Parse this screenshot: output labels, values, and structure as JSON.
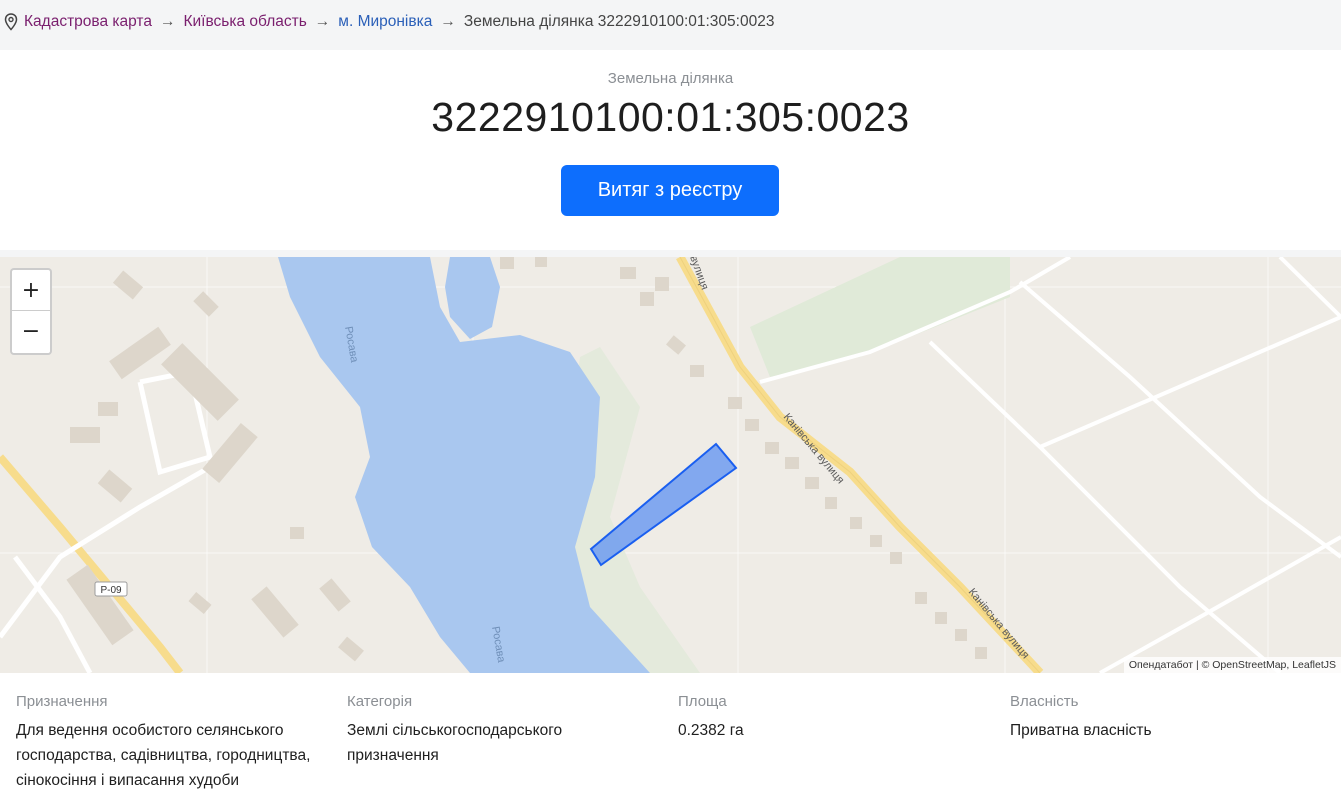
{
  "breadcrumb": {
    "pin_icon": "map-pin-icon",
    "items": [
      "Кадастрова карта",
      "Київська область",
      "м. Миронівка"
    ],
    "separator": "→",
    "current": "Земельна ділянка 3222910100:01:305:0023"
  },
  "header": {
    "label": "Земельна ділянка",
    "cadastral_number": "3222910100:01:305:0023",
    "extract_button": "Витяг з реєстру"
  },
  "map": {
    "zoom_in": "+",
    "zoom_out": "−",
    "labels": {
      "river_1": "Росава",
      "river_2": "Росава",
      "street_1": "Канівська вулиця",
      "street_2": "Канівська вулиця",
      "street_top": "вулиця",
      "road": "Р-09"
    },
    "attribution": "Опендатабот | © OpenStreetMap, LeafletJS",
    "colors": {
      "water": "#a9c7ef",
      "parcel_fill": "#6e9cf0",
      "parcel_stroke": "#1a5ff0",
      "road": "#f7dc8c"
    }
  },
  "properties": [
    {
      "label": "Призначення",
      "value": "Для ведення особистого селянського господарства, садівництва, городництва, сінокосіння і випасання худоби"
    },
    {
      "label": "Категорія",
      "value": "Землі сільськогосподарського призначення"
    },
    {
      "label": "Площа",
      "value": "0.2382 га"
    },
    {
      "label": "Власність",
      "value": "Приватна власність"
    }
  ]
}
